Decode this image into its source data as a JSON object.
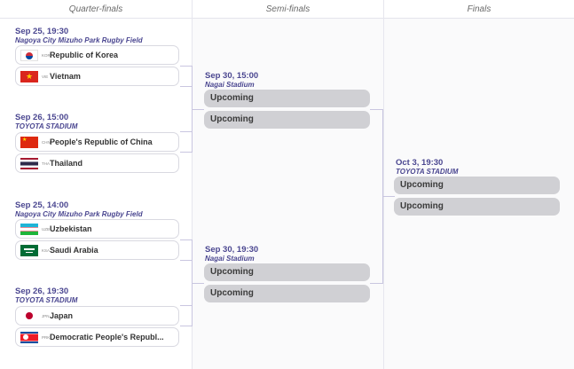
{
  "columns": {
    "qf": "Quarter-finals",
    "sf": "Semi-finals",
    "final": "Finals"
  },
  "quarter_finals": [
    {
      "date": "Sep 25, 19:30",
      "venue": "Nagoya City Mizuho Park Rugby Field",
      "teams": [
        {
          "code": "KOR",
          "name": "Republic of Korea",
          "flag": "korea-flag"
        },
        {
          "code": "VIE",
          "name": "Vietnam",
          "flag": "vietnam-flag"
        }
      ]
    },
    {
      "date": "Sep 26, 15:00",
      "venue": "TOYOTA STADIUM",
      "teams": [
        {
          "code": "CHN",
          "name": "People's Republic of China",
          "flag": "china-flag"
        },
        {
          "code": "THA",
          "name": "Thailand",
          "flag": "thailand-flag"
        }
      ]
    },
    {
      "date": "Sep 25, 14:00",
      "venue": "Nagoya City Mizuho Park Rugby Field",
      "teams": [
        {
          "code": "UZB",
          "name": "Uzbekistan",
          "flag": "uzbekistan-flag"
        },
        {
          "code": "KSA",
          "name": "Saudi Arabia",
          "flag": "saudi-arabia-flag"
        }
      ]
    },
    {
      "date": "Sep 26, 19:30",
      "venue": "TOYOTA STADIUM",
      "teams": [
        {
          "code": "JPN",
          "name": "Japan",
          "flag": "japan-flag"
        },
        {
          "code": "PRK",
          "name": "Democratic People's Republ...",
          "flag": "north-korea-flag"
        }
      ]
    }
  ],
  "semi_finals": [
    {
      "date": "Sep 30, 15:00",
      "venue": "Nagai Stadium",
      "slots": [
        "Upcoming",
        "Upcoming"
      ]
    },
    {
      "date": "Sep 30, 19:30",
      "venue": "Nagai Stadium",
      "slots": [
        "Upcoming",
        "Upcoming"
      ]
    }
  ],
  "final": {
    "date": "Oct 3, 19:30",
    "venue": "TOYOTA STADIUM",
    "slots": [
      "Upcoming",
      "Upcoming"
    ]
  },
  "colors": {
    "accent": "#4a4690",
    "connector": "#c9c6e0",
    "upcoming_bg": "#d0d0d4"
  }
}
